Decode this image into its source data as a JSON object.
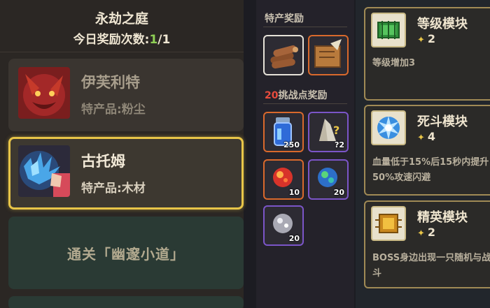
{
  "left_panel": {
    "title": "永劫之庭",
    "reward_count_label": "今日奖励次数:",
    "reward_count_current": "1",
    "reward_count_total": "/1",
    "cards": [
      {
        "name": "伊芙利特",
        "product": "特产品:粉尘"
      },
      {
        "name": "古托姆",
        "product": "特产品:木材"
      }
    ],
    "stage_label": "通关「幽邃小道」"
  },
  "middle_panel": {
    "specialty_label": "特产奖励",
    "challenge_number": "20",
    "challenge_label": "挑战点奖励",
    "challenge_items": [
      {
        "name": "blue-potion",
        "qty": "250"
      },
      {
        "name": "mystery-crystal",
        "qty": "?2"
      },
      {
        "name": "red-gem",
        "qty": "10"
      },
      {
        "name": "blue-green-gem",
        "qty": "20"
      },
      {
        "name": "silver-gem",
        "qty": "20"
      }
    ]
  },
  "right_panel": {
    "modules": [
      {
        "name": "等级模块",
        "level": "2",
        "desc": "等级增加3"
      },
      {
        "name": "死斗模块",
        "level": "4",
        "desc": "血量低于15%后15秒内提升50%攻速闪避"
      },
      {
        "name": "精英模块",
        "level": "2",
        "desc": "BOSS身边出现一只随机与战斗"
      }
    ]
  },
  "colors": {
    "highlight_border": "#e8c548",
    "count_green": "#8fcf55",
    "challenge_red": "#e84c3d"
  }
}
